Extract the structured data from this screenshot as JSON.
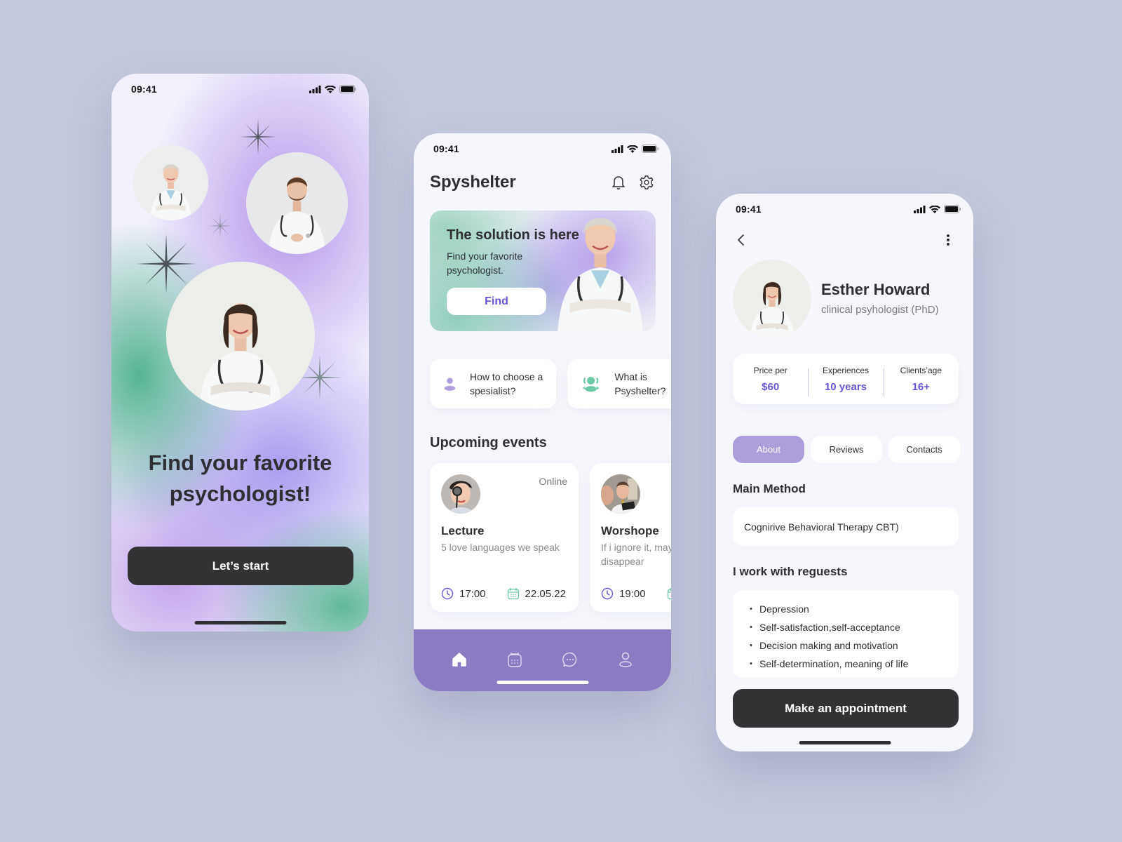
{
  "colors": {
    "background": "#c3c8dc",
    "accent_purple": "#6656d6",
    "tabbar_purple": "#8b7ac4",
    "pill_active": "#ae9edb",
    "dark_button": "#333335",
    "green_icon": "#6cc9a6"
  },
  "status_bar": {
    "time": "09:41",
    "icons": [
      "signal-icon",
      "wifi-icon",
      "battery-icon"
    ]
  },
  "onboarding": {
    "title_line1": "Find your favorite",
    "title_line2": "psychologist!",
    "start_button": "Let’s start"
  },
  "home": {
    "app_title": "Spyshelter",
    "header_icons": [
      "bell-icon",
      "gear-icon"
    ],
    "banner": {
      "title": "The solution is here",
      "subtitle": "Find your favorite psychologist.",
      "button": "Find"
    },
    "quick_links": [
      {
        "icon": "person-icon",
        "label": "How to choose a spesialist?"
      },
      {
        "icon": "group-icon",
        "label": "What is Psyshelter?"
      }
    ],
    "events_title": "Upcoming events",
    "events": [
      {
        "mode": "Online",
        "title": "Lecture",
        "description": "5 love languages we speak",
        "time": "17:00",
        "date": "22.05.22"
      },
      {
        "mode": "",
        "title": "Worshope",
        "description": "If i ignore it, maybe it will disappear",
        "time": "19:00",
        "date": ""
      }
    ],
    "tab_bar": [
      "home-icon",
      "calendar-icon",
      "chat-icon",
      "profile-icon"
    ],
    "active_tab": "home"
  },
  "profile": {
    "name": "Esther Howard",
    "role": "clinical psyhologist (PhD)",
    "stats": [
      {
        "label": "Price per",
        "value": "$60"
      },
      {
        "label": "Experiences",
        "value": "10 years"
      },
      {
        "label": "Clients’age",
        "value": "16+"
      }
    ],
    "tabs": [
      {
        "label": "About",
        "active": true
      },
      {
        "label": "Reviews",
        "active": false
      },
      {
        "label": "Contacts",
        "active": false
      }
    ],
    "main_method_title": "Main Method",
    "main_method": "Cognirive Behavioral Therapy CBT)",
    "requests_title": "I work with reguests",
    "requests": [
      "Depression",
      "Self-satisfaction,self-acceptance",
      "Decision making and motivation",
      "Self-determination, meaning of life"
    ],
    "appointment_button": "Make an appointment"
  }
}
